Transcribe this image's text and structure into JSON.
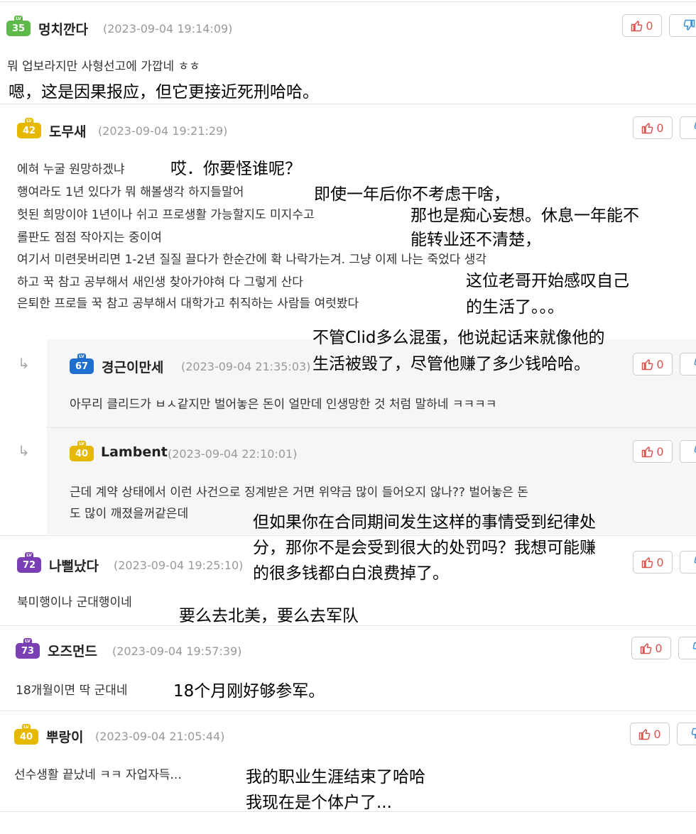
{
  "comments": [
    {
      "level": "35",
      "nick": "멍치깐다",
      "time": "(2023-09-04 19:14:09)",
      "likes": "0",
      "text_lines": [
        "뭐 업보라지만 사형선고에 가깝네 ㅎㅎ"
      ],
      "translation_lines": [
        "嗯，这是因果报应，但它更接近死刑哈哈。"
      ]
    },
    {
      "level": "42",
      "nick": "도무새",
      "time": "(2023-09-04 19:21:29)",
      "likes": "0",
      "text_lines": [
        "에혀 누굴 원망하겠냐",
        "행여라도 1년 있다가 뭐 해볼생각 하지들말어",
        "헛된 희망이야 1년이나 쉬고 프로생활 가능할지도 미지수고",
        "롤판도 점점 작아지는 중이여",
        "여기서 미련못버리면 1-2년 질질 끌다가 한순간에 확 나락가는겨. 그냥 이제 나는 죽었다 생각",
        "하고 꾹 참고 공부해서 새인생 찾아가야혀 다 그렇게 산다",
        "은퇴한 프로들 꾹 참고 공부해서 대학가고 취직하는 사람들 여럿봤다"
      ],
      "translation_lines": [
        "哎．你要怪谁呢？",
        "即使一年后你不考虑干啥，",
        "那也是痴心妄想。休息一年能不",
        "能转业还不清楚，",
        "这位老哥开始感叹自己",
        "的生活了。。。"
      ]
    },
    {
      "level": "67",
      "nick": "경근이만세",
      "time": "(2023-09-04 21:35:03)",
      "likes": "0",
      "text_lines": [
        "아무리 클리드가 ㅂㅅ같지만 벌어놓은 돈이 얼만데 인생망한 것 처럼 말하네 ㅋㅋㅋㅋ"
      ],
      "translation_lines": [
        "不管Clid多么混蛋，他说起话来就像他的",
        "生活被毁了，尽管他赚了多少钱哈哈。"
      ]
    },
    {
      "level": "40",
      "nick": "Lambent",
      "time": "(2023-09-04 22:10:01)",
      "likes": "0",
      "text_lines": [
        "근데 계약 상태에서 이런 사건으로 징계받은 거면 위약금 많이 들어오지 않나?? 벌어놓은 돈",
        "도 많이 깨졌을꺼같은데"
      ],
      "translation_lines": [
        "但如果你在合同期间发生这样的事情受到纪律处",
        "分，那你不是会受到很大的处罚吗？我想可能赚",
        "的很多钱都白白浪费掉了。"
      ]
    },
    {
      "level": "72",
      "nick": "나뻘났다",
      "time": "(2023-09-04 19:25:10)",
      "likes": "0",
      "text_lines": [
        "북미행이나 군대행이네"
      ],
      "translation_lines": [
        "要么去北美，要么去军队"
      ]
    },
    {
      "level": "73",
      "nick": "오즈먼드",
      "time": "(2023-09-04 19:57:39)",
      "likes": "0",
      "text_lines": [
        "18개월이면 딱 군대네"
      ],
      "translation_lines": [
        "18个月刚好够参军。"
      ]
    },
    {
      "level": "40",
      "nick": "뿌랑이",
      "time": "(2023-09-04 21:05:44)",
      "likes": "0",
      "text_lines": [
        "선수생활 끝났네 ㅋㅋ 자업자득..."
      ],
      "translation_lines": [
        "我的职业生涯结束了哈哈",
        "我现在是个体户了..."
      ]
    }
  ],
  "icons": {
    "like": "thumbs-up-icon",
    "dislike": "thumbs-down-icon",
    "reply": "reply-arrow-icon"
  },
  "colors": {
    "like": "#d9534f",
    "dislike": "#3a8fd8",
    "level_green": "#5eb84a",
    "level_yellow": "#e6b800",
    "level_purple": "#7a3fb5",
    "level_blue": "#1f6fd1"
  }
}
